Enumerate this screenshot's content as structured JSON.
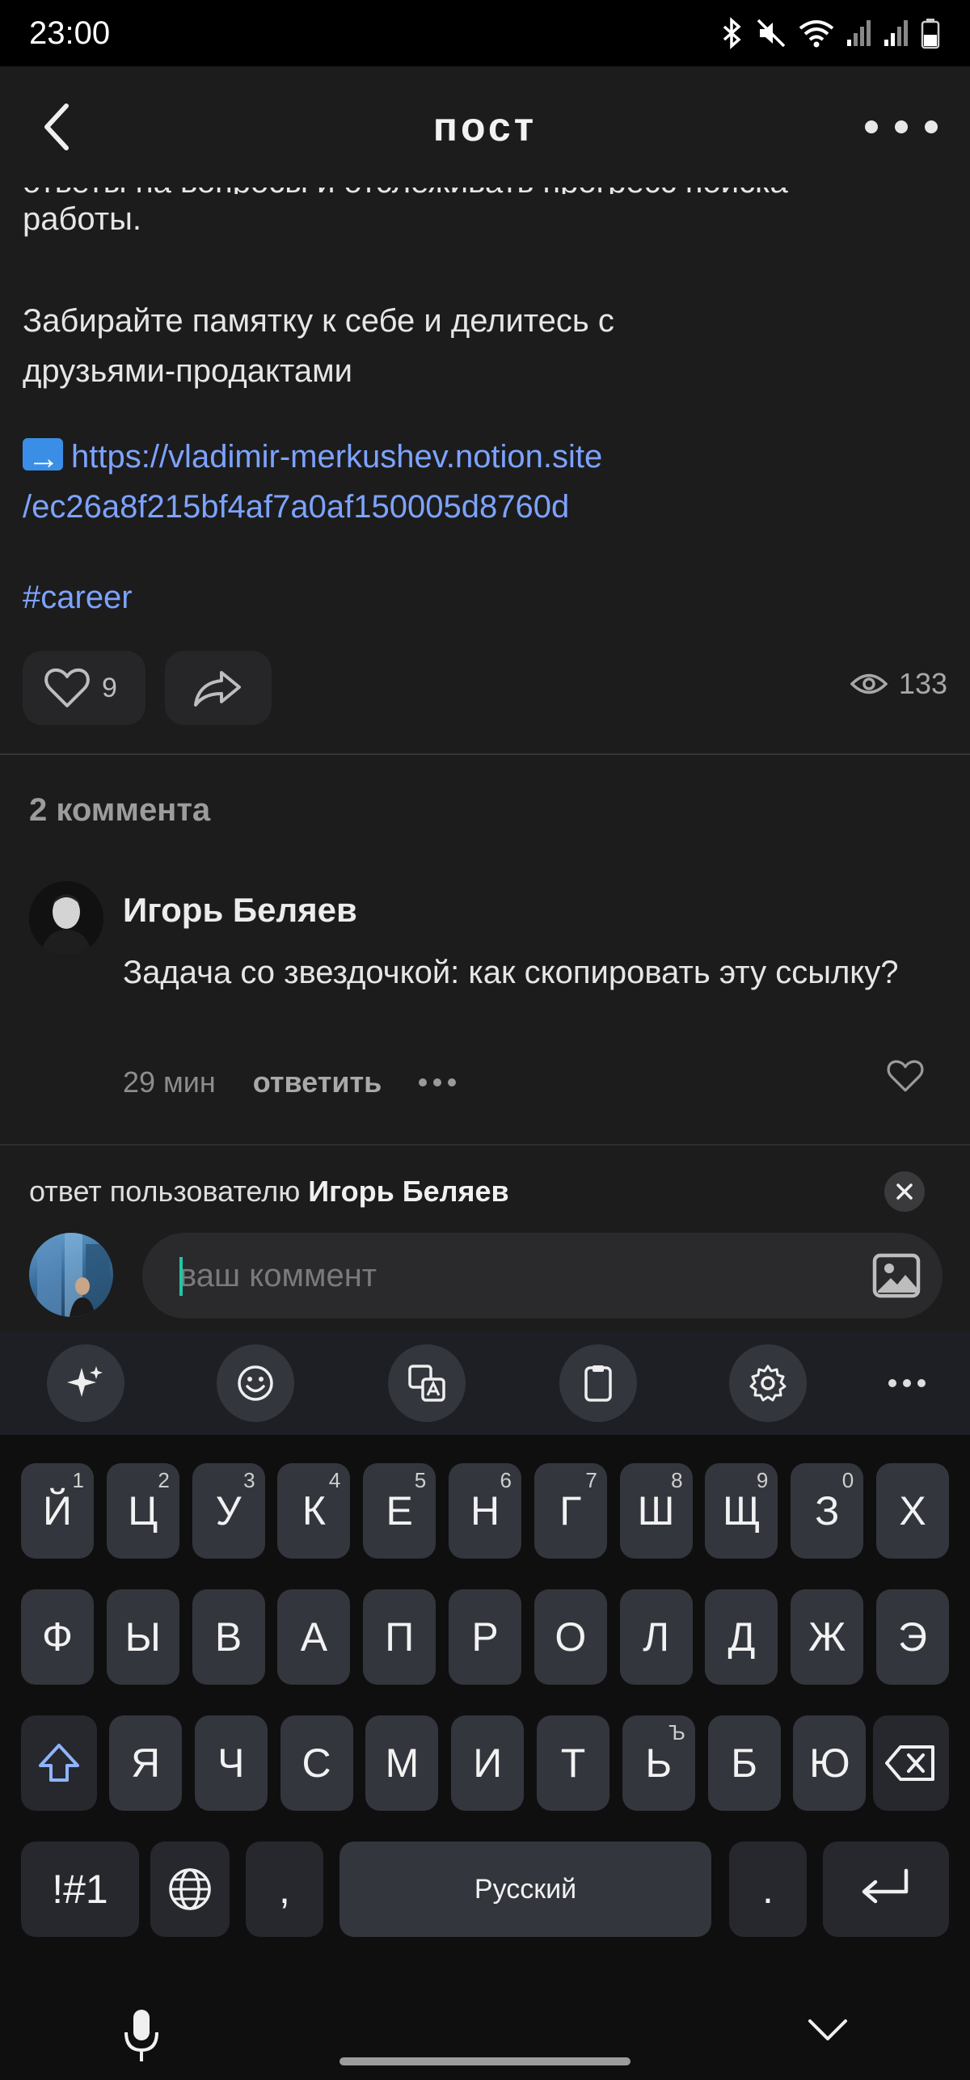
{
  "status_bar": {
    "time": "23:00"
  },
  "header": {
    "title": "пост"
  },
  "post": {
    "cut_line": "ответы на вопросы и отслеживать прогресс поиска",
    "line_work": "работы.",
    "para2_line1": "Забирайте памятку к себе и делитесь с",
    "para2_line2": "друзьями-продактами",
    "link_line1": "https://vladimir-merkushev.notion.site",
    "link_line2": "/ec26a8f215bf4af7a0af150005d8760d",
    "hashtag": "#career",
    "likes": "9",
    "views": "133"
  },
  "comments": {
    "count_label": "2 коммента",
    "items": [
      {
        "author": "Игорь Беляев",
        "text": "Задача со звездочкой: как скопировать эту ссылку?",
        "time": "29 мин",
        "reply_label": "ответить"
      }
    ]
  },
  "reply": {
    "prefix": "ответ пользователю ",
    "user": "Игорь Беляев",
    "placeholder": "ваш коммент"
  },
  "keyboard": {
    "row1": [
      {
        "k": "Й",
        "n": "1"
      },
      {
        "k": "Ц",
        "n": "2"
      },
      {
        "k": "У",
        "n": "3"
      },
      {
        "k": "К",
        "n": "4"
      },
      {
        "k": "Е",
        "n": "5"
      },
      {
        "k": "Н",
        "n": "6"
      },
      {
        "k": "Г",
        "n": "7"
      },
      {
        "k": "Ш",
        "n": "8"
      },
      {
        "k": "Щ",
        "n": "9"
      },
      {
        "k": "З",
        "n": "0"
      },
      {
        "k": "Х",
        "n": ""
      }
    ],
    "row2": [
      "Ф",
      "Ы",
      "В",
      "А",
      "П",
      "Р",
      "О",
      "Л",
      "Д",
      "Ж",
      "Э"
    ],
    "row3": [
      "Я",
      "Ч",
      "С",
      "М",
      "И",
      "Т",
      "Ь",
      "Б",
      "Ю"
    ],
    "row3_hint": "Ъ",
    "symbols_label": "!#1",
    "comma": ",",
    "space_label": "Русский",
    "period": "."
  }
}
